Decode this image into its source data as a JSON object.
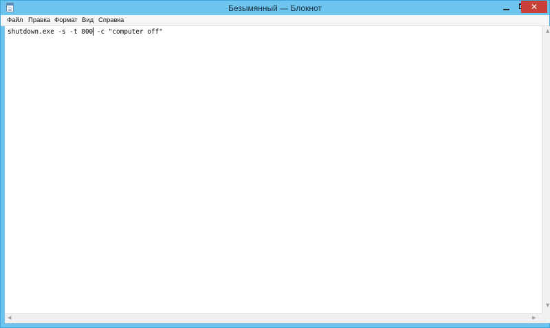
{
  "window": {
    "title": "Безымянный — Блокнот",
    "icon": "notepad-icon",
    "controls": {
      "minimize_icon": "minimize-icon",
      "maximize_icon": "maximize-icon",
      "close_icon": "close-icon",
      "close_glyph": "✕"
    }
  },
  "menu": {
    "items": [
      "Файл",
      "Правка",
      "Формат",
      "Вид",
      "Справка"
    ]
  },
  "editor": {
    "content": "shutdown.exe -s -t 800 -c \"computer off\""
  },
  "scrollbars": {
    "up_glyph": "▲",
    "down_glyph": "▼",
    "left_glyph": "◀",
    "right_glyph": "▶"
  },
  "colors": {
    "titlebar": "#6cc4ef",
    "close_button": "#c94039",
    "menubar": "#f5f6f7",
    "editor_background": "#ffffff"
  }
}
